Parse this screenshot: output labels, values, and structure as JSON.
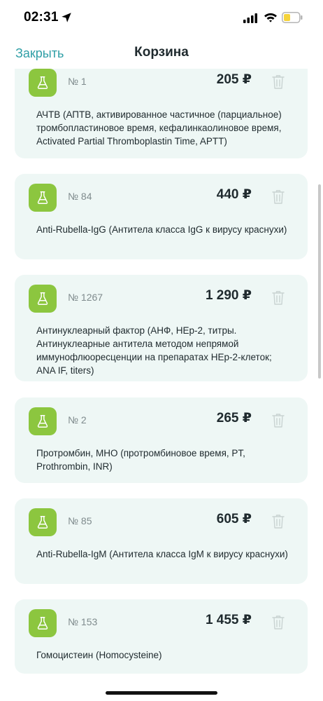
{
  "status": {
    "time": "02:31"
  },
  "nav": {
    "close_label": "Закрыть",
    "title": "Корзина"
  },
  "colors": {
    "accent": "#2f9fa6",
    "icon_bg": "#8cc63f",
    "card_bg": "#eef7f5",
    "battery": "#f5d33b"
  },
  "items": [
    {
      "number": "№ 1",
      "price": "205 ₽",
      "description": "АЧТВ (АПТВ, активированное частичное (парциальное) тромбопластиновое время, кефалинкаолиновое время, Activated Partial Thromboplastin Time, APTT)",
      "icon": "flask-icon"
    },
    {
      "number": "№ 84",
      "price": "440 ₽",
      "description": "Anti-Rubella-IgG (Антитела класса IgG к вирусу краснухи)",
      "icon": "flask-icon"
    },
    {
      "number": "№ 1267",
      "price": "1 290 ₽",
      "description": "Антинуклеарный фактор (АНФ, HEp-2, титры. Антинуклеарные антитела методом непрямой иммунофлюоресценции на препаратах HEp-2-клеток; ANA IF, titers)",
      "icon": "flask-icon"
    },
    {
      "number": "№ 2",
      "price": "265 ₽",
      "description": "Протромбин, МНО (протромбиновое время, PT, Prothrombin, INR)",
      "icon": "flask-icon"
    },
    {
      "number": "№ 85",
      "price": "605 ₽",
      "description": "Anti-Rubella-IgM (Антитела класса IgM к вирусу краснухи)",
      "icon": "flask-icon"
    },
    {
      "number": "№ 153",
      "price": "1 455 ₽",
      "description": "Гомоцистеин (Homocysteine)",
      "icon": "flask-icon"
    }
  ]
}
